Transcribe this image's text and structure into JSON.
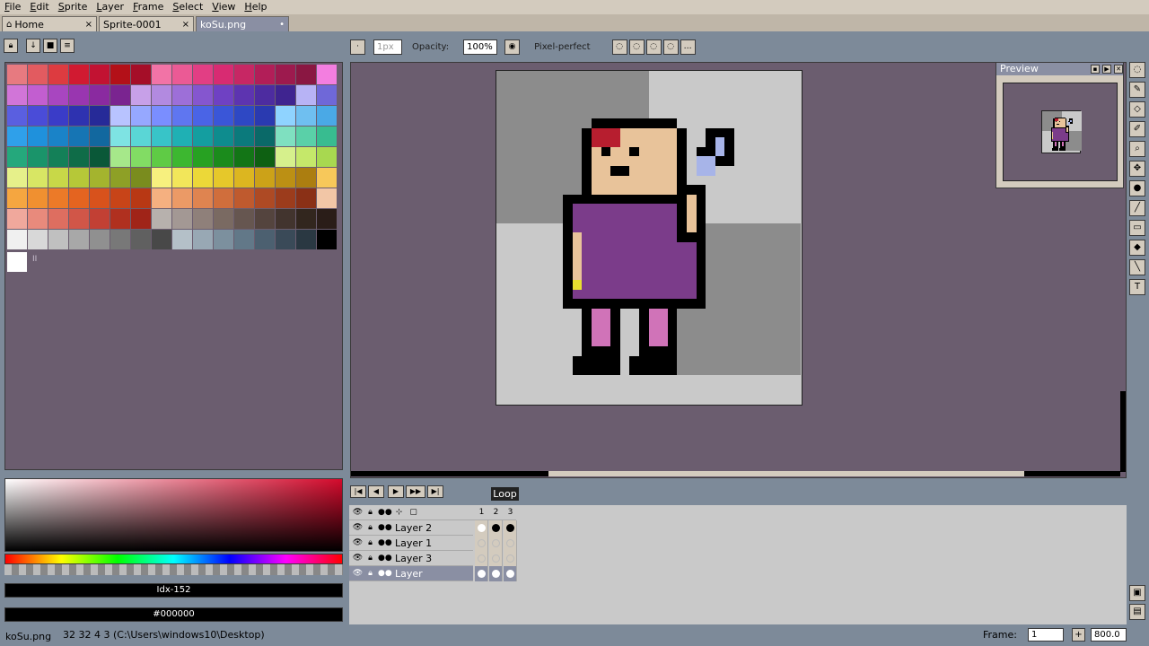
{
  "menu": [
    "File",
    "Edit",
    "Sprite",
    "Layer",
    "Frame",
    "Select",
    "View",
    "Help"
  ],
  "tabs": [
    {
      "label": "Home",
      "close": "×"
    },
    {
      "label": "Sprite-0001",
      "close": "×"
    },
    {
      "label": "koSu.png",
      "close": "•"
    }
  ],
  "context": {
    "size_value": "1px",
    "opacity_label": "Opacity:",
    "opacity_value": "100%",
    "pixel_perfect_label": "Pixel-perfect"
  },
  "palette": {
    "colors": [
      "#e77a80",
      "#e25b60",
      "#dd3b40",
      "#d11a31",
      "#c21232",
      "#b31018",
      "#a50e28",
      "#f273a6",
      "#eb5a95",
      "#e23e84",
      "#d82b72",
      "#c72764",
      "#b21e58",
      "#9d1a4e",
      "#8a1742",
      "#f37ee0",
      "#d175d8",
      "#c25ed0",
      "#a846c0",
      "#9936b0",
      "#8a2aa0",
      "#7a2490",
      "#c7a0e8",
      "#b28ae0",
      "#9d6fd8",
      "#8556cf",
      "#6f41c3",
      "#5d34b0",
      "#4d2ca0",
      "#3f2490",
      "#b7b3f5",
      "#6f68d8",
      "#5a5fe0",
      "#4a4cd8",
      "#3a3cc8",
      "#2e32b0",
      "#262a98",
      "#b8c3ff",
      "#96a8ff",
      "#7a8eff",
      "#5f76f0",
      "#4a64e6",
      "#3a56d8",
      "#2e48c4",
      "#2a3ab0",
      "#8fd3ff",
      "#6fbff0",
      "#4aa9e6",
      "#2fa0ea",
      "#1f91dc",
      "#1a83c8",
      "#1675b4",
      "#12689f",
      "#7ee3e3",
      "#5ad6d6",
      "#38c4c8",
      "#1fb0b4",
      "#149ea0",
      "#0e8c8e",
      "#0b7a7c",
      "#0a6968",
      "#7fe0c0",
      "#5ad0a8",
      "#38bc90",
      "#25a87c",
      "#1a946a",
      "#148058",
      "#0f6c48",
      "#0a5838",
      "#a6e88a",
      "#82dc64",
      "#5fcb45",
      "#3db730",
      "#27a122",
      "#1b8b1c",
      "#137516",
      "#0e6012",
      "#d6f08c",
      "#c5e86a",
      "#a8d850",
      "#e6f08a",
      "#d8e664",
      "#c8d848",
      "#b6c838",
      "#a4b42e",
      "#8ea026",
      "#7a8c1e",
      "#f7f07e",
      "#f2e65a",
      "#ecd838",
      "#e6c82a",
      "#dcb620",
      "#cca218",
      "#bc9014",
      "#ac7e10",
      "#f7c85a",
      "#f5a640",
      "#f09030",
      "#ec7a28",
      "#e46420",
      "#d8521c",
      "#c84418",
      "#b83814",
      "#f5b080",
      "#eb9a66",
      "#df8450",
      "#d06e3c",
      "#bf5a2e",
      "#ae4a24",
      "#9c3c1c",
      "#8a3016",
      "#f2c6a6",
      "#f0a89c",
      "#e88a7c",
      "#de6e60",
      "#d15648",
      "#c24034",
      "#b0301f",
      "#a02418",
      "#b7b1ad",
      "#a39894",
      "#8f807a",
      "#7a6a62",
      "#665650",
      "#54443e",
      "#42342e",
      "#32261e",
      "#2a1d18",
      "#f0f0f0",
      "#d8d8d8",
      "#c0c0c0",
      "#a8a8a8",
      "#909090",
      "#787878",
      "#606060",
      "#484848",
      "#b4c0c8",
      "#98a8b4",
      "#7c909e",
      "#627888",
      "#4c6070",
      "#3a4a58",
      "#2a3842",
      "#000000"
    ],
    "single": "#ffffff",
    "marker": "II"
  },
  "color": {
    "index_label": "Idx-152",
    "hex_label": "#000000"
  },
  "preview": {
    "title": "Preview"
  },
  "tools": [
    "◌",
    "✎",
    "◇",
    "✐",
    "⌕",
    "✥",
    "●",
    "╱",
    "▭",
    "◆",
    "╲",
    "T"
  ],
  "timeline": {
    "loop_tip": "Loop",
    "frames": [
      "1",
      "2",
      "3"
    ],
    "layers": [
      {
        "name": "Layer 2",
        "cels": [
          "full",
          "full",
          "full"
        ],
        "selected": false
      },
      {
        "name": "Layer 1",
        "cels": [
          "empty",
          "empty",
          "empty"
        ],
        "selected": false
      },
      {
        "name": "Layer 3",
        "cels": [
          "empty",
          "empty",
          "empty"
        ],
        "selected": false
      },
      {
        "name": "Layer",
        "cels": [
          "full",
          "full",
          "full"
        ],
        "selected": true
      }
    ]
  },
  "status": {
    "file": "koSu.png",
    "info": "32 32  4 3  (C:\\Users\\windows10\\Desktop)",
    "frame_label": "Frame:",
    "frame_value": "1",
    "zoom_value": "800.0",
    "zoom_btn": "+"
  },
  "sprite": {
    "skin": "#e8c39a",
    "shirt": "#7b3c8a",
    "pants": "#d073b8",
    "outline": "#000000",
    "hair_accent": "#b71e2f",
    "blade": "#a7b4e8",
    "bg_dark": "#8c8c8c",
    "bg_light": "#c9c9c9"
  }
}
